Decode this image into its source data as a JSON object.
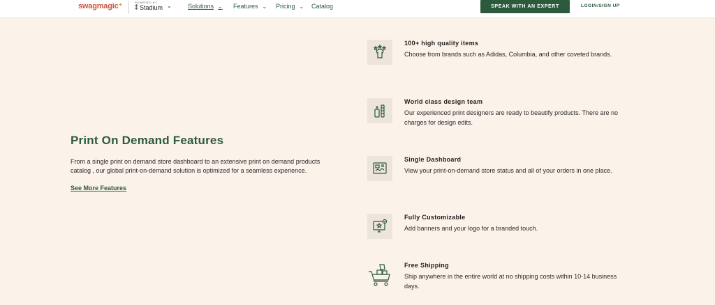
{
  "nav": {
    "logo": "swagmagic",
    "powered_by": "POWERED BY",
    "stadium": "Stadium",
    "links": [
      {
        "label": "Solutions"
      },
      {
        "label": "Features"
      },
      {
        "label": "Pricing"
      },
      {
        "label": "Catalog"
      }
    ],
    "cta": "SPEAK WITH AN EXPERT",
    "login": "LOGIN/SIGN UP"
  },
  "hero": {
    "title": "Print On Demand Features",
    "description": "From a single print on demand store dashboard to an extensive print on demand products catalog , our global print-on-demand solution is optimized for a seamless experience.",
    "link": "See More Features"
  },
  "features": [
    {
      "title": "100+ high quality items",
      "description": "Choose from brands such as Adidas, Columbia, and other coveted brands.",
      "icon": "tshirt-stars-icon"
    },
    {
      "title": "World class design team",
      "description": "Our experienced print designers are ready to beautify products. There are no charges for design edits.",
      "icon": "design-tools-icon"
    },
    {
      "title": "Single Dashboard",
      "description": "View your print-on-demand store status and all of your orders in one place.",
      "icon": "dashboard-icon"
    },
    {
      "title": "Fully Customizable",
      "description": "Add banners and your logo for a branded touch.",
      "icon": "monitor-star-icon"
    },
    {
      "title": "Free Shipping",
      "description": "Ship anywhere in the entire world at no shipping costs within 10-14 business days.",
      "icon": "shipping-cart-icon"
    }
  ],
  "colors": {
    "brand_green": "#2c5a3d",
    "logo": "#c8553d",
    "background": "#fbf2ea"
  }
}
